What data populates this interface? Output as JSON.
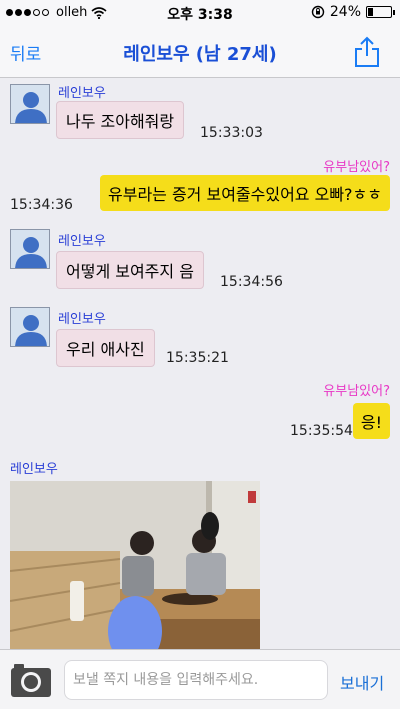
{
  "status_bar": {
    "carrier": "olleh",
    "time": "오후 3:38",
    "battery": "24%",
    "battery_level": 0.24
  },
  "nav": {
    "back_label": "뒤로",
    "title": "레인보우 (남 27세)"
  },
  "messages": [
    {
      "direction": "in",
      "sender": "레인보우",
      "text": "나두 조아해줘랑",
      "time": "15:33:03"
    },
    {
      "direction": "out",
      "sender": "유부남있어?",
      "text": "유부라는 증거 보여줄수있어요 오빠?ㅎㅎ",
      "time": "15:34:36"
    },
    {
      "direction": "in",
      "sender": "레인보우",
      "text": "어떻게 보여주지 음",
      "time": "15:34:56"
    },
    {
      "direction": "in",
      "sender": "레인보우",
      "text": "우리 애사진",
      "time": "15:35:21"
    },
    {
      "direction": "out",
      "sender": "유부남있어?",
      "text": "응!",
      "time": "15:35:54"
    },
    {
      "direction": "in",
      "sender": "레인보우",
      "type": "photo"
    }
  ],
  "composer": {
    "placeholder": "보낼 쪽지 내용을 입력해주세요.",
    "send_label": "보내기"
  },
  "colors": {
    "incoming_bubble": "#f1dfe6",
    "outgoing_bubble": "#f5dd1a",
    "sender_name": "#2a3fd6",
    "my_name": "#e838c6",
    "accent": "#1a7cf5"
  }
}
